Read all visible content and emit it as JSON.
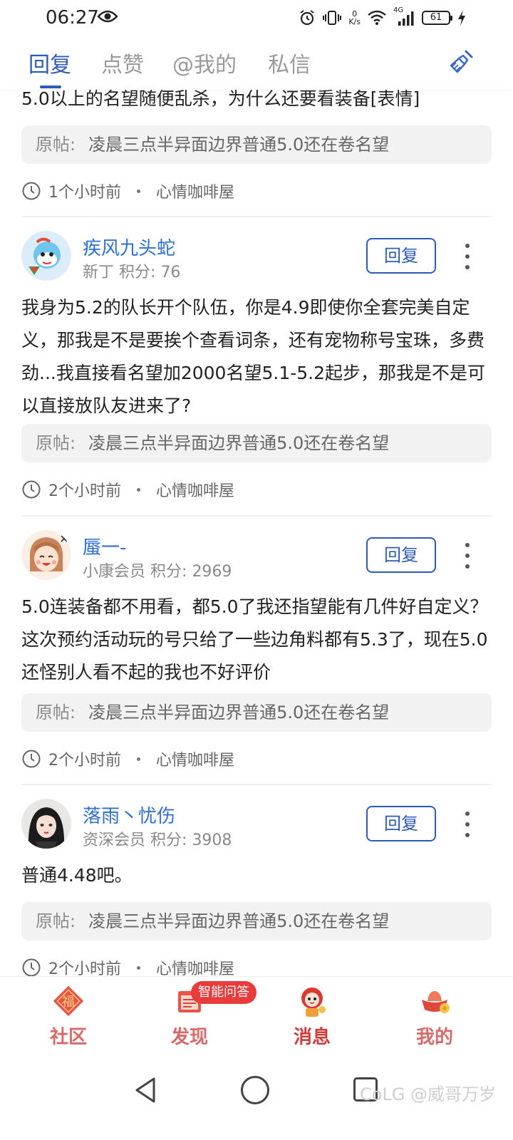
{
  "status_bar": {
    "time": "06:27",
    "net_speed_top": "0",
    "net_speed_bottom": "K/s",
    "network_type": "4G",
    "battery": "61"
  },
  "tabs": {
    "items": [
      {
        "label": "回复",
        "active": true
      },
      {
        "label": "点赞",
        "active": false
      },
      {
        "label": "@我的",
        "active": false
      },
      {
        "label": "私信",
        "active": false
      }
    ],
    "accent_color": "#2f5bb8"
  },
  "feed": {
    "partial_post": {
      "content": "5.0以上的名望随便乱杀，为什么还要看装备[表情]",
      "original_label": "原帖:",
      "original_title": "凌晨三点半异面边界普通5.0还在卷名望",
      "time": "1个小时前",
      "forum": "心情咖啡屋"
    },
    "posts": [
      {
        "username": "疾风九头蛇",
        "rank": "新丁",
        "points_label": "积分:",
        "points": "76",
        "reply_label": "回复",
        "content": "我身为5.2的队长开个队伍，你是4.9即使你全套完美自定义，那我是不是要挨个查看词条，还有宠物称号宝珠，多费劲...我直接看名望加2000名望5.1-5.2起步，那我是不是可以直接放队友进来了?",
        "original_label": "原帖:",
        "original_title": "凌晨三点半异面边界普通5.0还在卷名望",
        "time": "2个小时前",
        "forum": "心情咖啡屋"
      },
      {
        "username": "蜃一-",
        "rank": "小康会员",
        "points_label": "积分:",
        "points": "2969",
        "reply_label": "回复",
        "content": "5.0连装备都不用看，都5.0了我还指望能有几件好自定义？这次预约活动玩的号只给了一些边角料都有5.3了，现在5.0还怪别人看不起的我也不好评价",
        "original_label": "原帖:",
        "original_title": "凌晨三点半异面边界普通5.0还在卷名望",
        "time": "2个小时前",
        "forum": "心情咖啡屋"
      },
      {
        "username": "落雨丶忧伤",
        "rank": "资深会员",
        "points_label": "积分:",
        "points": "3908",
        "reply_label": "回复",
        "content": "普通4.48吧。",
        "original_label": "原帖:",
        "original_title": "凌晨三点半异面边界普通5.0还在卷名望",
        "time": "2个小时前",
        "forum": "心情咖啡屋"
      }
    ]
  },
  "bottom_nav": {
    "items": [
      {
        "label": "社区",
        "icon": "fu-icon"
      },
      {
        "label": "发现",
        "icon": "discover-icon"
      },
      {
        "label": "消息",
        "icon": "message-mascot-icon",
        "active": true
      },
      {
        "label": "我的",
        "icon": "gold-ingot-icon"
      }
    ],
    "badge": "智能问答"
  },
  "watermark": "CoLG @威哥万岁"
}
